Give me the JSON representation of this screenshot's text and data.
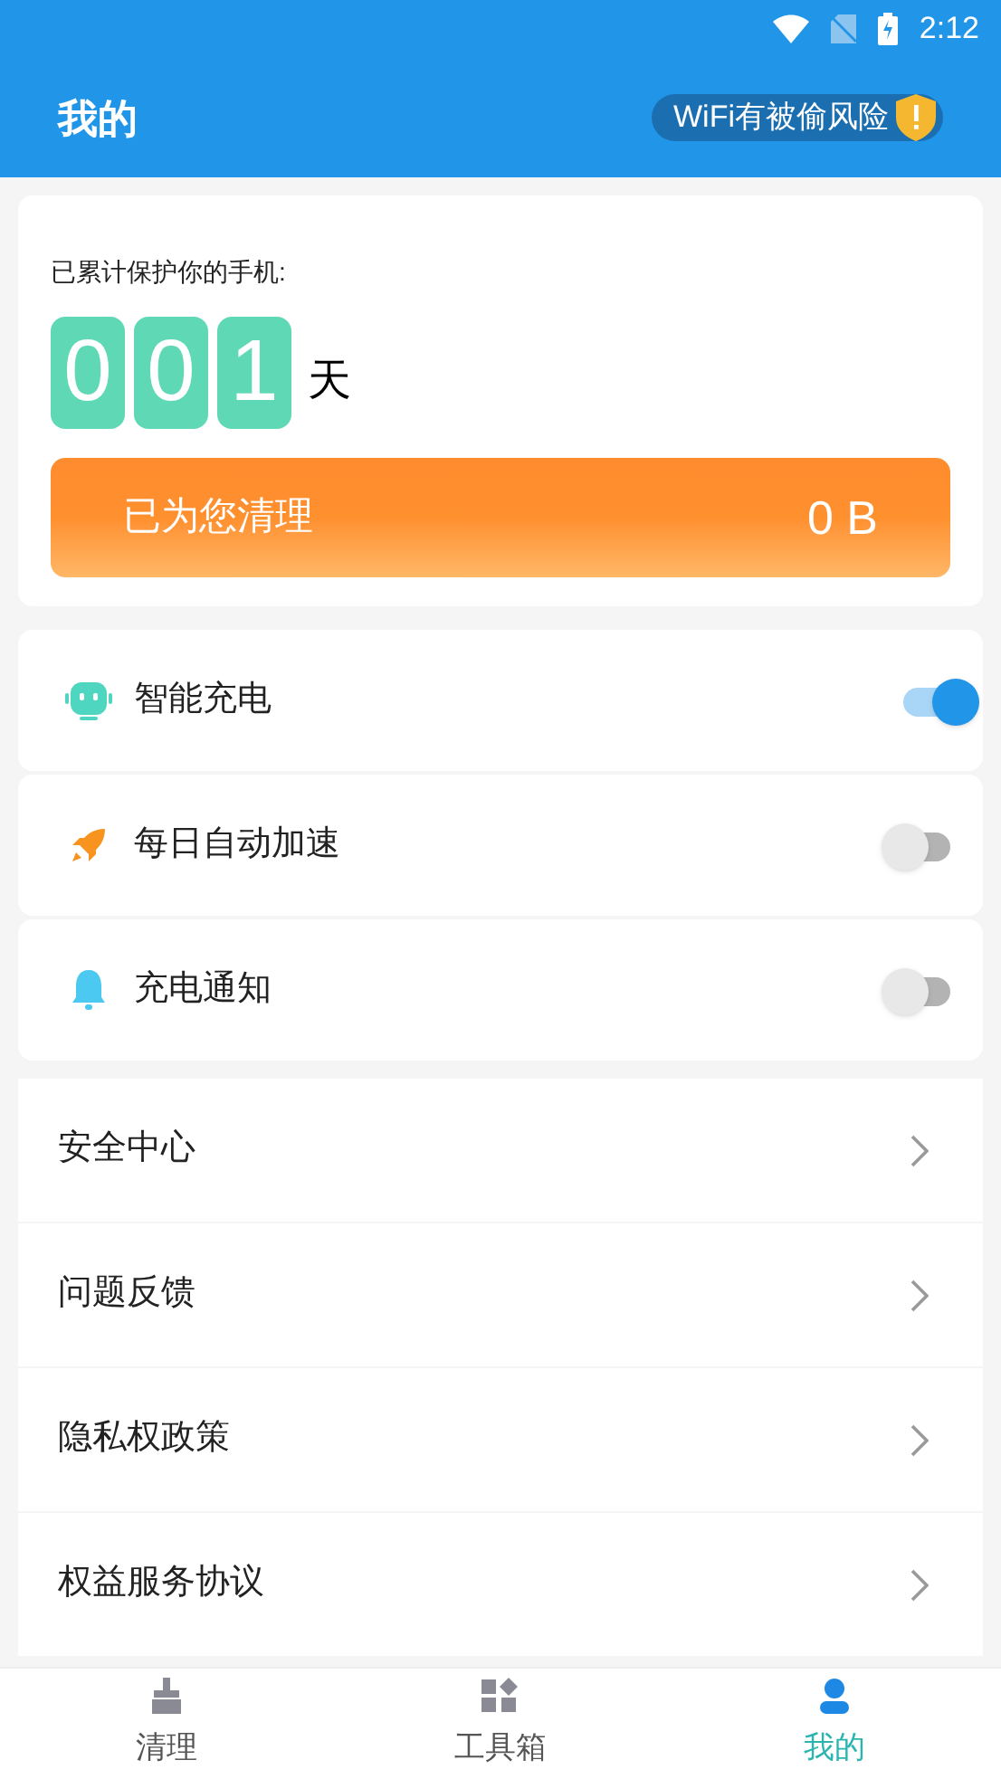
{
  "status_bar": {
    "time": "2:12"
  },
  "header": {
    "title": "我的",
    "warning": "WiFi有被偷风险"
  },
  "protection": {
    "label": "已累计保护你的手机:",
    "digits": [
      "0",
      "0",
      "1"
    ],
    "unit": "天"
  },
  "cleaned": {
    "label": "已为您清理",
    "value": "0 B"
  },
  "toggles": [
    {
      "kind": "robot",
      "label": "智能充电",
      "on": true
    },
    {
      "kind": "rocket",
      "label": "每日自动加速",
      "on": false
    },
    {
      "kind": "bell",
      "label": "充电通知",
      "on": false
    }
  ],
  "menu": [
    "安全中心",
    "问题反馈",
    "隐私权政策",
    "权益服务协议"
  ],
  "tabs": [
    {
      "kind": "broom",
      "label": "清理",
      "selected": false
    },
    {
      "kind": "tools",
      "label": "工具箱",
      "selected": false
    },
    {
      "kind": "user",
      "label": "我的",
      "selected": true
    }
  ]
}
